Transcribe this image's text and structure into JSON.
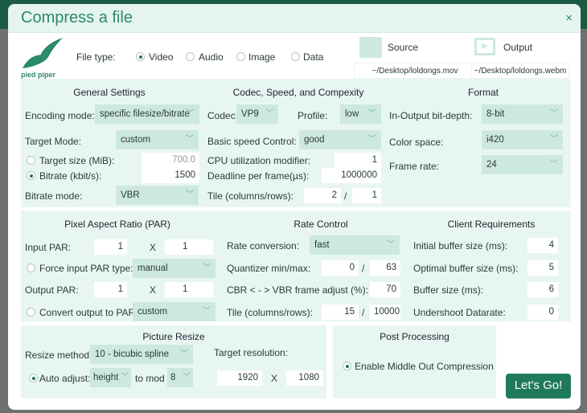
{
  "dialog": {
    "title": "Compress a file",
    "close": "×"
  },
  "logo": {
    "text": "pied piper"
  },
  "file_type": {
    "label": "File type:",
    "options": [
      "Video",
      "Audio",
      "Image",
      "Data"
    ],
    "selected": "Video"
  },
  "source": {
    "label": "Source",
    "path": "~/Desktop/loldongs.mov"
  },
  "output": {
    "label": "Output",
    "path": "~/Desktop/loldongs.webm"
  },
  "general": {
    "title": "General Settings",
    "encoding_label": "Encoding mode:",
    "encoding": "specific filesize/bitrate",
    "target_mode_label": "Target Mode:",
    "target_mode": "custom",
    "target_size_label": "Target size (MiB):",
    "target_size": "700.0",
    "bitrate_label": "Bitrate (kbit/s):",
    "bitrate": "1500",
    "bitrate_mode_label": "Bitrate mode:",
    "bitrate_mode": "VBR"
  },
  "codec": {
    "title": "Codec, Speed, and Compexity",
    "codec_label": "Codec:",
    "codec": "VP9",
    "profile_label": "Profile:",
    "profile": "low",
    "speed_label": "Basic speed Control:",
    "speed": "good",
    "cpu_label": "CPU utilization modifier:",
    "cpu": "1",
    "deadline_label": "Deadline per frame(µs):",
    "deadline": "1000000",
    "tile_label": "Tile (columns/rows):",
    "tile_cols": "2",
    "tile_rows": "1",
    "sep": "/"
  },
  "format": {
    "title": "Format",
    "bitdepth_label": "In-Output bit-depth:",
    "bitdepth": "8-bit",
    "colorspace_label": "Color space:",
    "colorspace": "i420",
    "framerate_label": "Frame rate:",
    "framerate": "24"
  },
  "par": {
    "title": "Pixel Aspect Ratio (PAR)",
    "input_label": "Input PAR:",
    "input_w": "1",
    "input_h": "1",
    "x": "X",
    "force_label": "Force input PAR type:",
    "force": "manual",
    "output_label": "Output PAR:",
    "output_w": "1",
    "output_h": "1",
    "convert_label": "Convert output to PAR:",
    "convert": "custom"
  },
  "rate": {
    "title": "Rate Control",
    "conversion_label": "Rate conversion:",
    "conversion": "fast",
    "quant_label": "Quantizer min/max:",
    "quant_min": "0",
    "quant_max": "63",
    "cbr_label": "CBR < - > VBR frame adjust (%):",
    "cbr": "70",
    "tile_label": "Tile (columns/rows):",
    "tile_cols": "15",
    "tile_rows": "10000",
    "sep": "/"
  },
  "client": {
    "title": "Client Requirements",
    "initial_label": "Initial buffer size (ms):",
    "initial": "4",
    "optimal_label": "Optimal buffer size (ms):",
    "optimal": "5",
    "buffer_label": "Buffer size (ms):",
    "buffer": "6",
    "undershoot_label": "Undershoot Datarate:",
    "undershoot": "0"
  },
  "resize": {
    "title": "Picture Resize",
    "method_label": "Resize method:",
    "method": "10 - bicubic spline",
    "target_label": "Target resolution:",
    "auto_label": "Auto adjust:",
    "auto": "height",
    "mod_label": "to mod",
    "mod": "8",
    "width": "1920",
    "height": "1080",
    "x": "X"
  },
  "post": {
    "title": "Post Processing",
    "middle_out": "Enable Middle Out Compression"
  },
  "go_button": "Let's Go!",
  "colors": {
    "accent": "#1f7a5a",
    "panel": "#e8f6f1",
    "select": "#cde9df"
  }
}
